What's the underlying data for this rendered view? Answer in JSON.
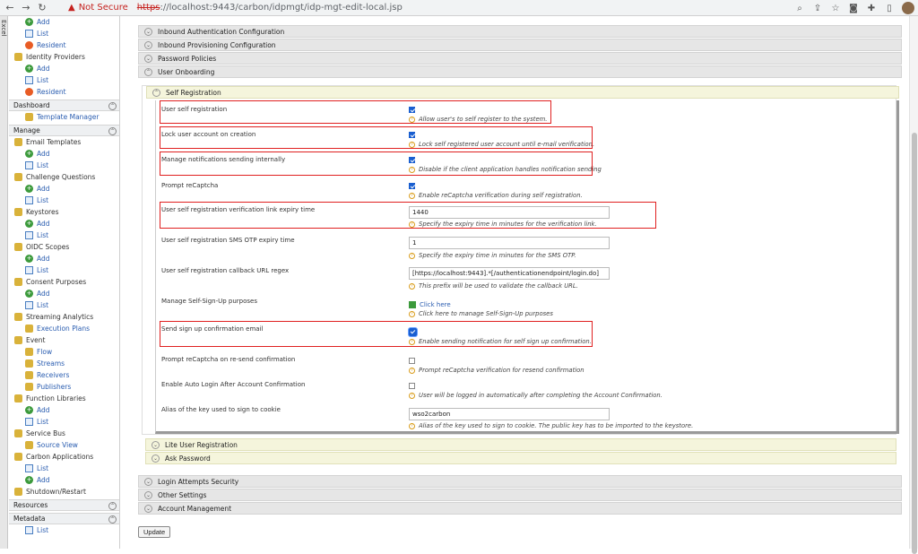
{
  "browser": {
    "security_label": "Not Secure",
    "url_scheme": "https",
    "url_rest": "://localhost:9443/carbon/idpmgt/idp-mgt-edit-local.jsp"
  },
  "excel_tab": "Excel",
  "sidebar": {
    "items": [
      {
        "type": "sub",
        "icon": "add-icon",
        "label": "Add"
      },
      {
        "type": "sub",
        "icon": "list-icon",
        "label": "List"
      },
      {
        "type": "sub",
        "icon": "resident-icon",
        "label": "Resident"
      },
      {
        "type": "cat",
        "icon": "identity-providers-icon",
        "label": "Identity Providers"
      },
      {
        "type": "sub",
        "icon": "add-icon",
        "label": "Add"
      },
      {
        "type": "sub",
        "icon": "list-icon",
        "label": "List"
      },
      {
        "type": "sub",
        "icon": "resident-icon",
        "label": "Resident"
      },
      {
        "type": "head",
        "label": "Dashboard"
      },
      {
        "type": "sub",
        "icon": "template-icon",
        "label": "Template Manager"
      },
      {
        "type": "head",
        "label": "Manage"
      },
      {
        "type": "cat",
        "icon": "email-icon",
        "label": "Email Templates"
      },
      {
        "type": "sub",
        "icon": "add-icon",
        "label": "Add"
      },
      {
        "type": "sub",
        "icon": "list-icon",
        "label": "List"
      },
      {
        "type": "cat",
        "icon": "question-icon",
        "label": "Challenge Questions"
      },
      {
        "type": "sub",
        "icon": "add-icon",
        "label": "Add"
      },
      {
        "type": "sub",
        "icon": "list-icon",
        "label": "List"
      },
      {
        "type": "cat",
        "icon": "key-icon",
        "label": "Keystores"
      },
      {
        "type": "sub",
        "icon": "add-icon",
        "label": "Add"
      },
      {
        "type": "sub",
        "icon": "list-icon",
        "label": "List"
      },
      {
        "type": "cat",
        "icon": "oidc-icon",
        "label": "OIDC Scopes"
      },
      {
        "type": "sub",
        "icon": "add-icon",
        "label": "Add"
      },
      {
        "type": "sub",
        "icon": "list-icon",
        "label": "List"
      },
      {
        "type": "cat",
        "icon": "consent-icon",
        "label": "Consent Purposes"
      },
      {
        "type": "sub",
        "icon": "add-icon",
        "label": "Add"
      },
      {
        "type": "sub",
        "icon": "list-icon",
        "label": "List"
      },
      {
        "type": "cat",
        "icon": "analytics-icon",
        "label": "Streaming Analytics"
      },
      {
        "type": "sub",
        "icon": "plan-icon",
        "label": "Execution Plans"
      },
      {
        "type": "cat",
        "icon": "event-icon",
        "label": "Event"
      },
      {
        "type": "sub",
        "icon": "flow-icon",
        "label": "Flow"
      },
      {
        "type": "sub",
        "icon": "streams-icon",
        "label": "Streams"
      },
      {
        "type": "sub",
        "icon": "receivers-icon",
        "label": "Receivers"
      },
      {
        "type": "sub",
        "icon": "publishers-icon",
        "label": "Publishers"
      },
      {
        "type": "cat",
        "icon": "function-icon",
        "label": "Function Libraries"
      },
      {
        "type": "sub",
        "icon": "add-icon",
        "label": "Add"
      },
      {
        "type": "sub",
        "icon": "list-icon",
        "label": "List"
      },
      {
        "type": "cat",
        "icon": "bus-icon",
        "label": "Service Bus"
      },
      {
        "type": "sub",
        "icon": "source-icon",
        "label": "Source View"
      },
      {
        "type": "cat",
        "icon": "carbon-icon",
        "label": "Carbon Applications"
      },
      {
        "type": "sub",
        "icon": "list-icon",
        "label": "List"
      },
      {
        "type": "sub",
        "icon": "add-icon",
        "label": "Add"
      },
      {
        "type": "cat",
        "icon": "shutdown-icon",
        "label": "Shutdown/Restart"
      },
      {
        "type": "head",
        "label": "Resources"
      },
      {
        "type": "head",
        "label": "Metadata"
      },
      {
        "type": "sub",
        "icon": "list-icon",
        "label": "List"
      }
    ]
  },
  "sections": {
    "inbound_auth": "Inbound Authentication Configuration",
    "inbound_prov": "Inbound Provisioning Configuration",
    "password_policies": "Password Policies",
    "user_onboarding": "User Onboarding",
    "self_registration": "Self Registration",
    "lite_user": "Lite User Registration",
    "ask_password": "Ask Password",
    "login_attempts": "Login Attempts Security",
    "other_settings": "Other Settings",
    "account_management": "Account Management"
  },
  "form": {
    "user_self_registration": {
      "label": "User self registration",
      "hint": "Allow user's to self register to the system.",
      "checked": true
    },
    "lock_account": {
      "label": "Lock user account on creation",
      "hint": "Lock self registered user account until e-mail verification.",
      "checked": true
    },
    "manage_notifications": {
      "label": "Manage notifications sending internally",
      "hint": "Disable if the client application handles notification sending",
      "checked": true
    },
    "prompt_recaptcha": {
      "label": "Prompt reCaptcha",
      "hint": "Enable reCaptcha verification during self registration.",
      "checked": true
    },
    "verification_expiry": {
      "label": "User self registration verification link expiry time",
      "value": "1440",
      "hint": "Specify the expiry time in minutes for the verification link."
    },
    "sms_otp_expiry": {
      "label": "User self registration SMS OTP expiry time",
      "value": "1",
      "hint": "Specify the expiry time in minutes for the SMS OTP."
    },
    "callback_regex": {
      "label": "User self registration callback URL regex",
      "value": "[https://localhost:9443].*[/authenticationendpoint/login.do]",
      "hint": "This prefix will be used to validate the callback URL."
    },
    "manage_purposes": {
      "label": "Manage Self-Sign-Up purposes",
      "link": "Click here",
      "hint": "Click here to manage Self-Sign-Up purposes"
    },
    "send_confirmation": {
      "label": "Send sign up confirmation email",
      "hint": "Enable sending notification for self sign up confirmation.",
      "checked": true
    },
    "recaptcha_resend": {
      "label": "Prompt reCaptcha on re-send confirmation",
      "hint": "Prompt reCaptcha verification for resend confirmation",
      "checked": false
    },
    "auto_login": {
      "label": "Enable Auto Login After Account Confirmation",
      "hint": "User will be logged in automatically after completing the Account Confirmation.",
      "checked": false
    },
    "key_alias": {
      "label": "Alias of the key used to sign to cookie",
      "value": "wso2carbon",
      "hint": "Alias of the key used to sign to cookie. The public key has to be imported to the keystore."
    }
  },
  "update_label": "Update"
}
